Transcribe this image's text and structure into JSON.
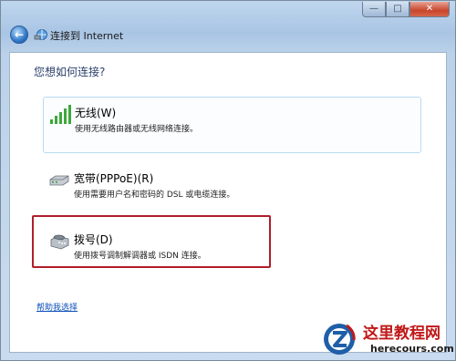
{
  "window": {
    "title": "连接到 Internet",
    "controls": {
      "minimize": "—",
      "maximize": "□",
      "close": "✕"
    }
  },
  "question": "您想如何连接?",
  "options": [
    {
      "title": "无线(W)",
      "description": "使用无线路由器或无线网络连接。",
      "icon": "wireless-signal-icon"
    },
    {
      "title": "宽带(PPPoE)(R)",
      "description": "使用需要用户名和密码的 DSL 或电缆连接。",
      "icon": "broadband-modem-icon"
    },
    {
      "title": "拨号(D)",
      "description": "使用拨号调制解调器或 ISDN 连接。",
      "icon": "dialup-phone-icon"
    }
  ],
  "help_link": "帮助我选择",
  "watermark": {
    "name_cn": "这里教程网",
    "url": "herecours.com"
  },
  "colors": {
    "highlight": "#b01e2a",
    "link": "#0b4fb8",
    "accent_border": "#b8dbf2"
  }
}
